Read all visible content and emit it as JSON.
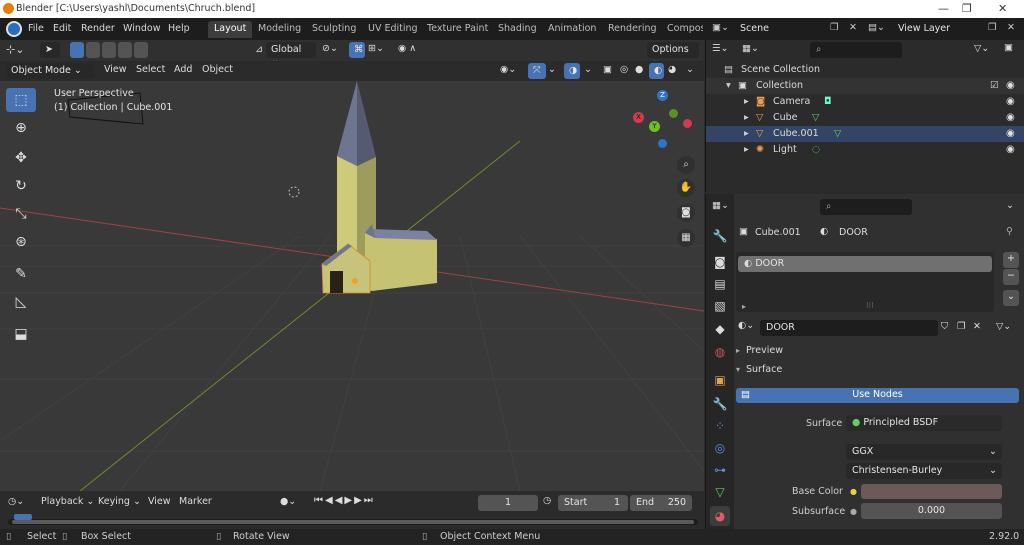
{
  "window": {
    "title": "Blender [C:\\Users\\yashl\\Documents\\Chruch.blend]",
    "controls": [
      "—",
      "❐",
      "✕"
    ]
  },
  "menubar": {
    "items": [
      "File",
      "Edit",
      "Render",
      "Window",
      "Help"
    ],
    "workspace_tabs": [
      "Layout",
      "Modeling",
      "Sculpting",
      "UV Editing",
      "Texture Paint",
      "Shading",
      "Animation",
      "Rendering",
      "Compos"
    ],
    "scene": "Scene",
    "view_layer": "View Layer"
  },
  "viewport_header": {
    "transform": "Global",
    "options": "Options",
    "mode": "Object Mode",
    "menus": [
      "View",
      "Select",
      "Add",
      "Object"
    ]
  },
  "viewport": {
    "perspective": "User Perspective",
    "collection_info": "(1) Collection | Cube.001",
    "gizmo": {
      "z": "Z",
      "y": "Y",
      "x": "X"
    }
  },
  "outliner": {
    "search_placeholder": "",
    "root": "Scene Collection",
    "collection": "Collection",
    "items": [
      {
        "name": "Camera"
      },
      {
        "name": "Cube"
      },
      {
        "name": "Cube.001"
      },
      {
        "name": "Light"
      }
    ]
  },
  "properties": {
    "object": "Cube.001",
    "material": "DOOR",
    "slot": "DOOR",
    "material_field": "DOOR",
    "panels": {
      "preview": "Preview",
      "surface": "Surface"
    },
    "use_nodes": "Use Nodes",
    "surface_label": "Surface",
    "surface_value": "Principled BSDF",
    "distribution": "GGX",
    "subsurface_method": "Christensen-Burley",
    "base_color_label": "Base Color",
    "base_color": "#6b5a57",
    "subsurface_label": "Subsurface",
    "subsurface_value": "0.000"
  },
  "timeline": {
    "menus": [
      "Playback",
      "Keying",
      "View",
      "Marker"
    ],
    "current_frame": "1",
    "start_label": "Start",
    "start": "1",
    "end_label": "End",
    "end": "250"
  },
  "statusbar": {
    "select": "Select",
    "box_select": "Box Select",
    "rotate": "Rotate View",
    "context": "Object Context Menu",
    "version": "2.92.0"
  }
}
